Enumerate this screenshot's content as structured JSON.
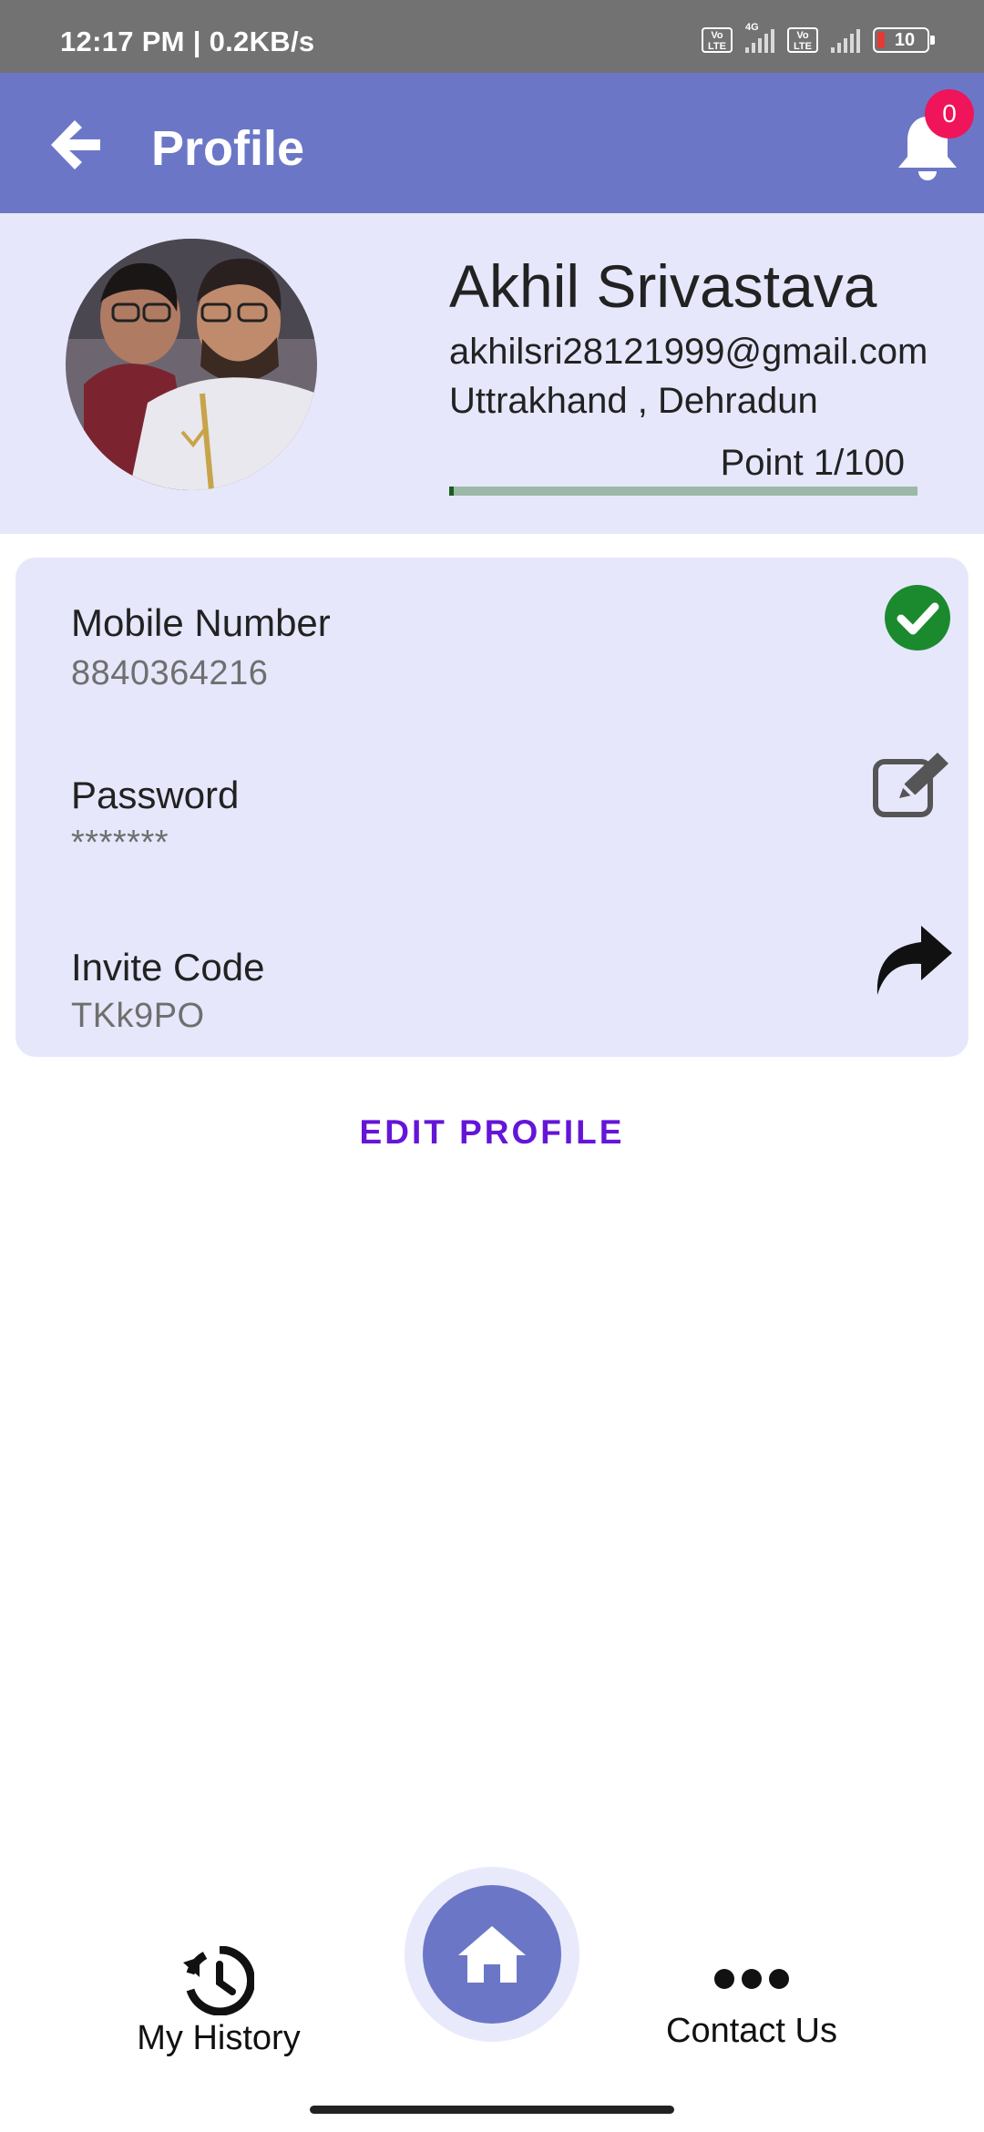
{
  "status_bar": {
    "time_speed": "12:17 PM | 0.2KB/s",
    "volte1": "Vo LTE",
    "network_tag": "4G",
    "volte2": "Vo LTE",
    "battery": "10"
  },
  "app_bar": {
    "title": "Profile",
    "notification_count": "0"
  },
  "profile": {
    "name": "Akhil Srivastava",
    "email": "akhilsri28121999@gmail.com",
    "location": "Uttrakhand , Dehradun",
    "points_label": "Point 1/100",
    "points_progress": 0.01
  },
  "details": {
    "mobile_label": "Mobile Number",
    "mobile_value": "8840364216",
    "password_label": "Password",
    "password_value": "*******",
    "invite_label": "Invite Code",
    "invite_value": "TKk9PO"
  },
  "actions": {
    "edit_profile": "EDIT PROFILE"
  },
  "bottom_nav": {
    "history_label": "My History",
    "contact_label": "Contact Us"
  },
  "colors": {
    "app_bar": "#6b77c6",
    "card_bg": "#e6e7fb",
    "accent": "#6515d8",
    "badge": "#f0145a",
    "verified": "#1b8a2e"
  },
  "icons": {
    "back": "arrow-left-icon",
    "notifications": "bell-icon",
    "verified": "check-circle-icon",
    "edit": "edit-icon",
    "share": "share-icon",
    "history": "history-icon",
    "home": "home-icon",
    "more": "more-horizontal-icon"
  }
}
